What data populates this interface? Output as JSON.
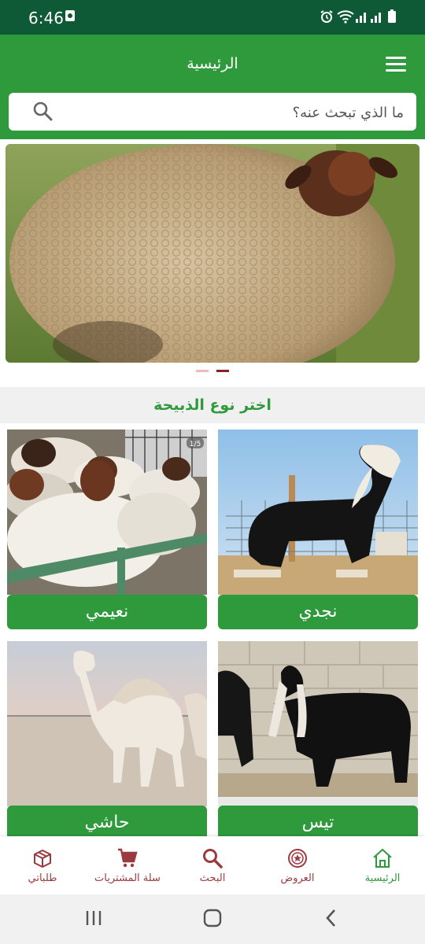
{
  "status_bar": {
    "time": "6:46"
  },
  "app_bar": {
    "title": "الرئيسية"
  },
  "search": {
    "placeholder": "ما الذي تبحث عنه؟"
  },
  "banner": {
    "image": "sheep-photo",
    "active_slide": 2,
    "slide_count": 2
  },
  "section": {
    "title": "اختر نوع الذبيحة"
  },
  "categories": [
    {
      "label": "نجدي",
      "image": "black-goat-photo"
    },
    {
      "label": "نعيمي",
      "image": "sheep-flock-photo",
      "badge": "1/5"
    },
    {
      "label": "تيس",
      "image": "black-billy-goat-photo"
    },
    {
      "label": "حاشي",
      "image": "camel-photo"
    }
  ],
  "bottom_nav": [
    {
      "label": "الرئيسية",
      "icon": "home-icon",
      "active": true
    },
    {
      "label": "العروض",
      "icon": "offers-badge-icon",
      "active": false
    },
    {
      "label": "البحث",
      "icon": "search-icon",
      "active": false
    },
    {
      "label": "سلة المشتريات",
      "icon": "cart-icon",
      "active": false
    },
    {
      "label": "طلباتي",
      "icon": "orders-box-icon",
      "active": false
    }
  ],
  "colors": {
    "primary": "#2e9a3c",
    "status_bar": "#0e5a37",
    "nav_inactive": "#9c3a3f",
    "nav_active": "#2e9a3c"
  }
}
